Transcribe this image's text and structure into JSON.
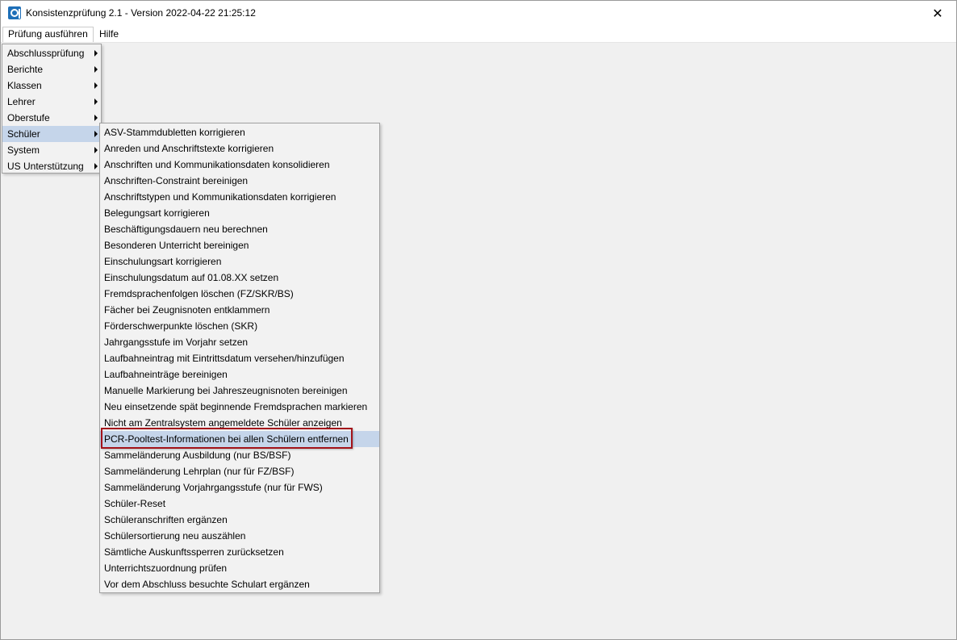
{
  "window": {
    "title": "Konsistenzprüfung 2.1 - Version 2022-04-22 21:25:12",
    "close_glyph": "✕",
    "icon": "app-logo-icon"
  },
  "menubar": {
    "items": [
      {
        "label": "Prüfung ausführen"
      },
      {
        "label": "Hilfe"
      }
    ]
  },
  "main_menu": {
    "items": [
      {
        "label": "Abschlussprüfung",
        "has_submenu": true
      },
      {
        "label": "Berichte",
        "has_submenu": true
      },
      {
        "label": "Klassen",
        "has_submenu": true
      },
      {
        "label": "Lehrer",
        "has_submenu": true
      },
      {
        "label": "Oberstufe",
        "has_submenu": true
      },
      {
        "label": "Schüler",
        "has_submenu": true,
        "selected": true
      },
      {
        "label": "System",
        "has_submenu": true
      },
      {
        "label": "US Unterstützung",
        "has_submenu": true
      }
    ]
  },
  "submenu": {
    "items": [
      {
        "label": "ASV-Stammdubletten korrigieren"
      },
      {
        "label": "Anreden und Anschriftstexte korrigieren"
      },
      {
        "label": "Anschriften und Kommunikationsdaten konsolidieren"
      },
      {
        "label": "Anschriften-Constraint bereinigen"
      },
      {
        "label": "Anschriftstypen und Kommunikationsdaten korrigieren"
      },
      {
        "label": "Belegungsart korrigieren"
      },
      {
        "label": "Beschäftigungsdauern neu berechnen"
      },
      {
        "label": "Besonderen Unterricht bereinigen"
      },
      {
        "label": "Einschulungsart korrigieren"
      },
      {
        "label": "Einschulungsdatum auf 01.08.XX setzen"
      },
      {
        "label": "Fremdsprachenfolgen löschen (FZ/SKR/BS)"
      },
      {
        "label": "Fächer bei Zeugnisnoten entklammern"
      },
      {
        "label": "Förderschwerpunkte löschen (SKR)"
      },
      {
        "label": "Jahrgangsstufe im Vorjahr setzen"
      },
      {
        "label": "Laufbahneintrag mit Eintrittsdatum versehen/hinzufügen"
      },
      {
        "label": "Laufbahneinträge bereinigen"
      },
      {
        "label": "Manuelle Markierung bei Jahreszeugnisnoten bereinigen"
      },
      {
        "label": "Neu einsetzende spät beginnende Fremdsprachen markieren"
      },
      {
        "label": "Nicht am Zentralsystem angemeldete Schüler anzeigen"
      },
      {
        "label": "PCR-Pooltest-Informationen bei allen Schülern entfernen",
        "highlighted": true
      },
      {
        "label": "Sammeländerung Ausbildung (nur BS/BSF)"
      },
      {
        "label": "Sammeländerung Lehrplan (nur für FZ/BSF)"
      },
      {
        "label": "Sammeländerung Vorjahrgangsstufe (nur für FWS)"
      },
      {
        "label": "Schüler-Reset"
      },
      {
        "label": "Schüleranschriften ergänzen"
      },
      {
        "label": "Schülersortierung neu auszählen"
      },
      {
        "label": "Sämtliche Auskunftssperren zurücksetzen"
      },
      {
        "label": "Unterrichtszuordnung prüfen"
      },
      {
        "label": "Vor dem Abschluss besuchte Schulart ergänzen"
      }
    ]
  },
  "colors": {
    "highlight_bg": "#c5d5ea",
    "annotation_border": "#a3131a",
    "app_icon": "#1e6fb8"
  }
}
